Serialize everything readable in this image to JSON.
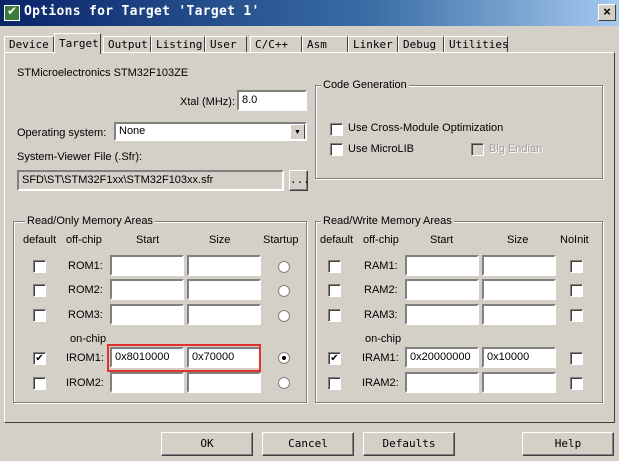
{
  "window": {
    "title": "Options for Target 'Target 1'",
    "close_glyph": "×"
  },
  "tabs": [
    {
      "label": "Device"
    },
    {
      "label": "Target"
    },
    {
      "label": "Output"
    },
    {
      "label": "Listing"
    },
    {
      "label": "User"
    },
    {
      "label": "C/C++"
    },
    {
      "label": "Asm"
    },
    {
      "label": "Linker"
    },
    {
      "label": "Debug"
    },
    {
      "label": "Utilities"
    }
  ],
  "active_tab": "Target",
  "device": {
    "name": "STMicroelectronics STM32F103ZE",
    "xtal_label": "Xtal (MHz):",
    "xtal_value": "8.0",
    "os_label": "Operating system:",
    "os_value": "None",
    "sfr_label": "System-Viewer File (.Sfr):",
    "sfr_value": "SFD\\ST\\STM32F1xx\\STM32F103xx.sfr",
    "browse_label": "..."
  },
  "code_generation": {
    "title": "Code Generation",
    "cross_module": {
      "label": "Use Cross-Module Optimization",
      "checked": false
    },
    "microlib": {
      "label": "Use MicroLIB",
      "checked": false
    },
    "big_endian": {
      "label": "Big Endian",
      "checked": false,
      "disabled": true
    }
  },
  "readonly_memory": {
    "title": "Read/Only Memory Areas",
    "headers": {
      "default": "default",
      "offchip": "off-chip",
      "start": "Start",
      "size": "Size",
      "extra": "Startup"
    },
    "onchip_label": "on-chip",
    "rows": [
      {
        "name": "ROM1:",
        "start": "",
        "size": "",
        "default": false,
        "startup": false
      },
      {
        "name": "ROM2:",
        "start": "",
        "size": "",
        "default": false,
        "startup": false
      },
      {
        "name": "ROM3:",
        "start": "",
        "size": "",
        "default": false,
        "startup": false
      },
      {
        "name": "IROM1:",
        "start": "0x8010000",
        "size": "0x70000",
        "default": true,
        "startup": true
      },
      {
        "name": "IROM2:",
        "start": "",
        "size": "",
        "default": false,
        "startup": false
      }
    ]
  },
  "readwrite_memory": {
    "title": "Read/Write Memory Areas",
    "headers": {
      "default": "default",
      "offchip": "off-chip",
      "start": "Start",
      "size": "Size",
      "extra": "NoInit"
    },
    "onchip_label": "on-chip",
    "rows": [
      {
        "name": "RAM1:",
        "start": "",
        "size": "",
        "default": false,
        "noinit": false
      },
      {
        "name": "RAM2:",
        "start": "",
        "size": "",
        "default": false,
        "noinit": false
      },
      {
        "name": "RAM3:",
        "start": "",
        "size": "",
        "default": false,
        "noinit": false
      },
      {
        "name": "IRAM1:",
        "start": "0x20000000",
        "size": "0x10000",
        "default": true,
        "noinit": false
      },
      {
        "name": "IRAM2:",
        "start": "",
        "size": "",
        "default": false,
        "noinit": false
      }
    ]
  },
  "buttons": {
    "ok": "OK",
    "cancel": "Cancel",
    "defaults": "Defaults",
    "help": "Help"
  },
  "colors": {
    "highlight": "#e03030",
    "titlebar": "#0a246a",
    "dialog": "#d4d0c8"
  }
}
